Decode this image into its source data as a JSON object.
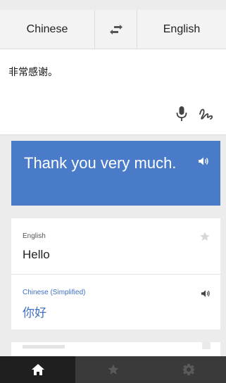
{
  "languages": {
    "source": "Chinese",
    "target": "English",
    "swap_icon": "swap-arrows-icon"
  },
  "input": {
    "text": "非常感谢。",
    "mic_icon": "microphone-icon",
    "handwriting_icon": "handwriting-icon"
  },
  "result": {
    "text": "Thank you very much.",
    "speaker_icon": "speaker-icon"
  },
  "cards": [
    {
      "language": "English",
      "word": "Hello",
      "action_icon": "star-icon"
    },
    {
      "language": "Chinese (Simplified)",
      "word": "你好",
      "action_icon": "speaker-icon"
    }
  ],
  "nav": [
    {
      "icon": "home-icon",
      "active": true
    },
    {
      "icon": "star-icon",
      "active": false
    },
    {
      "icon": "gear-icon",
      "active": false
    }
  ],
  "colors": {
    "accent": "#4a7bc8",
    "link_blue": "#3f6fc1",
    "nav_dark": "#2d2d2d"
  }
}
